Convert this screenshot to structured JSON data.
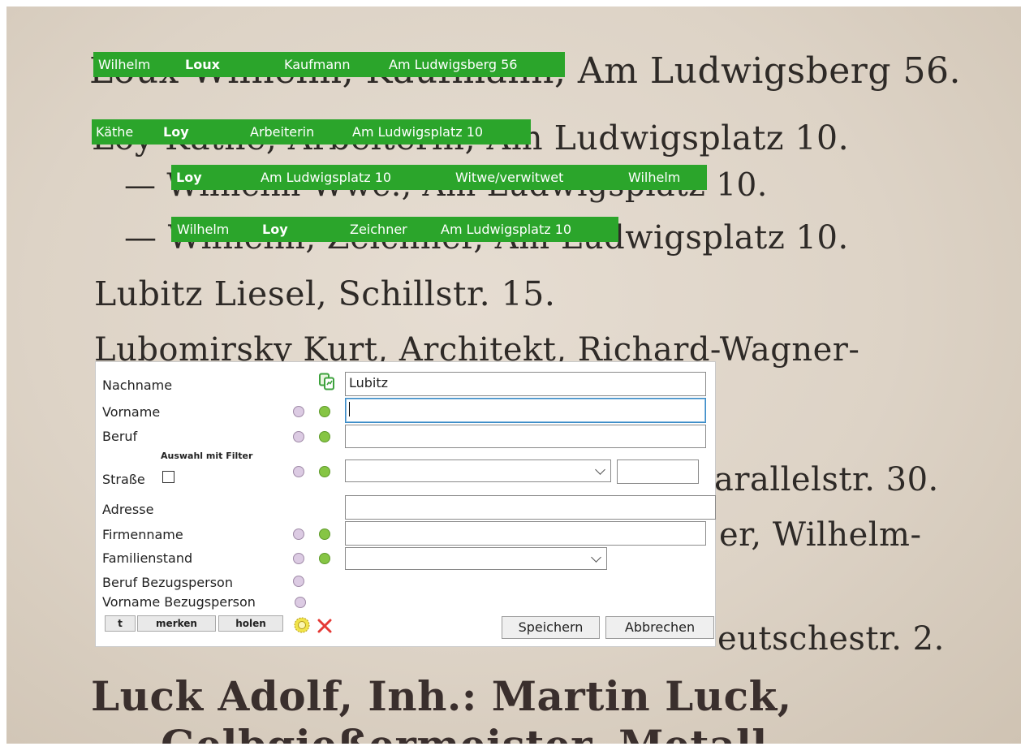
{
  "scan_text": [
    "Loux Wilhelm, Kaufmann, Am Ludwigsberg 56.",
    "Loy Käthe, Arbeiterin, Am Ludwigsplatz 10.",
    "— Wilhelm Wwe., Am Ludwigsplatz 10.",
    "— Wilhelm, Zeichner, Am Ludwigsplatz 10.",
    "Lubitz Liesel, Schillstr. 15.",
    "Lubomirsky Kurt, Architekt, Richard-Wagner-",
    "arallelstr. 30.",
    "er, Wilhelm-",
    "eutschestr. 2.",
    "Luck Adolf, Inh.: Martin Luck,",
    "Gelbgießermeister, Metall"
  ],
  "highlights": [
    {
      "fields": [
        "Wilhelm",
        "Loux",
        "Kaufmann",
        "Am Ludwigsberg 56"
      ]
    },
    {
      "fields": [
        "Käthe",
        "Loy",
        "Arbeiterin",
        "Am Ludwigsplatz 10"
      ]
    },
    {
      "fields": [
        "Loy",
        "Am Ludwigsplatz 10",
        "Witwe/verwitwet",
        "Wilhelm"
      ]
    },
    {
      "fields": [
        "Wilhelm",
        "Loy",
        "Zeichner",
        "Am Ludwigsplatz 10"
      ]
    }
  ],
  "form": {
    "nachname_label": "Nachname",
    "nachname_value": "Lubitz",
    "vorname_label": "Vorname",
    "vorname_value": "",
    "beruf_label": "Beruf",
    "beruf_value": "",
    "filter_label": "Auswahl mit Filter",
    "strasse_label": "Straße",
    "strasse_value": "",
    "hausnummer_value": "",
    "adresse_label": "Adresse",
    "adresse_value": "",
    "firmenname_label": "Firmenname",
    "firmenname_value": "",
    "familienstand_label": "Familienstand",
    "familienstand_value": "",
    "beruf_bezug_label": "Beruf Bezugsperson",
    "vorname_bezug_label": "Vorname Bezugsperson"
  },
  "buttons": {
    "t": "t",
    "merken": "merken",
    "holen": "holen",
    "speichern": "Speichern",
    "abbrechen": "Abbrechen"
  },
  "colors": {
    "highlight": "#2ba52b",
    "circle_purple": "#dccbe3",
    "circle_green": "#86c544",
    "cancel_x": "#e53935"
  },
  "icons": {
    "copy": "copy-icon",
    "settings": "sun-gear-icon",
    "cancel": "close-icon"
  }
}
